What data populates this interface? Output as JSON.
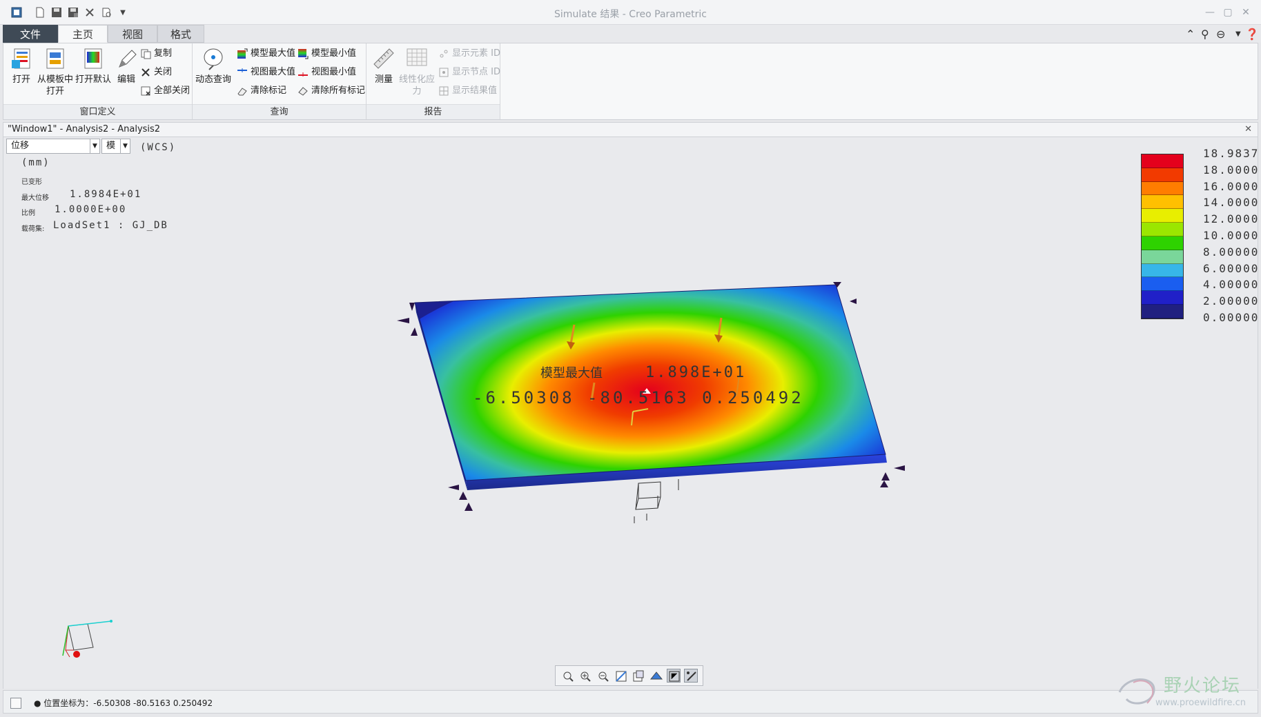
{
  "window_title": "Simulate 结果 - Creo Parametric",
  "tabs": [
    {
      "label": "文件"
    },
    {
      "label": "主页"
    },
    {
      "label": "视图"
    },
    {
      "label": "格式"
    }
  ],
  "ribbon": {
    "group_window": {
      "label": "窗口定义",
      "open": "打开",
      "open_template_1": "从模板中",
      "open_template_2": "打开",
      "open_default": "打开默认",
      "edit": "编辑",
      "copy": "复制",
      "close": "关闭",
      "close_all": "全部关闭"
    },
    "group_query": {
      "label": "查询",
      "dynamic_query": "动态查询",
      "model_max": "模型最大值",
      "model_min": "模型最小值",
      "view_max": "视图最大值",
      "view_min": "视图最小值",
      "clear_marks": "清除标记",
      "clear_all_marks": "清除所有标记"
    },
    "group_report": {
      "label": "报告",
      "measure": "测量",
      "linearized_1": "线性化应",
      "linearized_2": "力",
      "show_element_id": "显示元素 ID",
      "show_node_id": "显示节点 ID",
      "show_result_value": "显示结果值"
    }
  },
  "model_window": {
    "title": "\"Window1\" - Analysis2 - Analysis2",
    "quantity_select": "位移",
    "component_select": "模",
    "coord_system": "(WCS)",
    "units": "(mm)",
    "deformed": "已变形",
    "max_disp_label": "最大位移",
    "max_disp_value": "1.8984E+01",
    "scale_label": "比例",
    "scale_value": "1.0000E+00",
    "loadset_label": "载荷集:",
    "loadset_value": "LoadSet1 :  GJ_DB",
    "annotation_label": "模型最大值",
    "annotation_value": "1.898E+01",
    "annotation_coords": "-6.50308 -80.5163  0.250492"
  },
  "legend": {
    "values": [
      "18.9837",
      "18.0000",
      "16.0000",
      "14.0000",
      "12.0000",
      "10.0000",
      "8.00000",
      "6.00000",
      "4.00000",
      "2.00000",
      "0.00000"
    ],
    "colors": [
      "#e4001c",
      "#f23a00",
      "#ff7d00",
      "#ffc000",
      "#e8ee00",
      "#9be600",
      "#2ed200",
      "#7ad69a",
      "#37b6e8",
      "#1a5ef0",
      "#2020c8",
      "#202080"
    ]
  },
  "status": {
    "message": "● 位置坐标为：-6.50308  -80.5163  0.250492"
  },
  "watermark": {
    "title": "野火论坛",
    "url": "www.proewildfire.cn"
  }
}
